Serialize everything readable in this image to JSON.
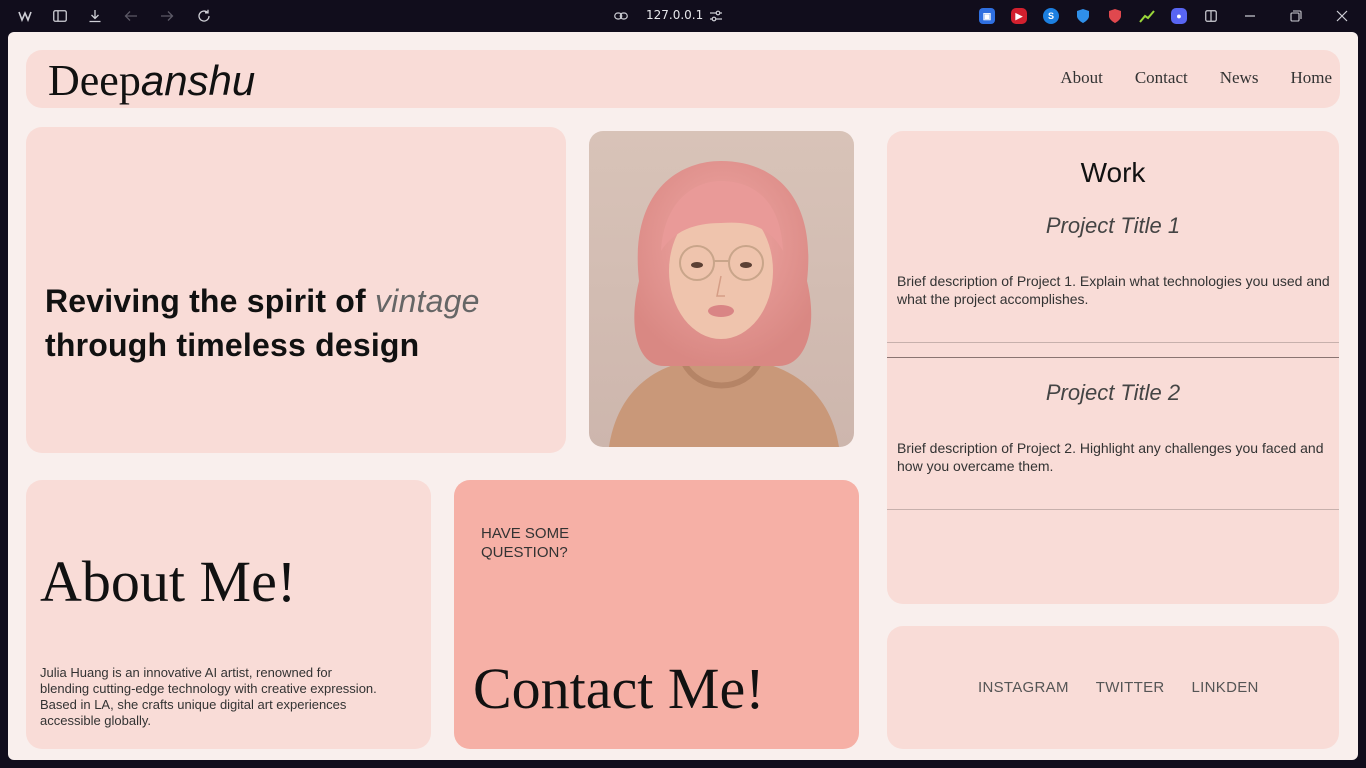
{
  "browser": {
    "url": "127.0.0.1"
  },
  "site": {
    "logo_regular": "Deep",
    "logo_italic": "anshu",
    "nav": [
      "About",
      "Contact",
      "News",
      "Home"
    ]
  },
  "hero": {
    "line1": "Reviving the spirit of",
    "emphasis": "vintage",
    "line2": "through timeless design"
  },
  "photo": {
    "subject": "portrait of a woman with pink bob hair and round glasses"
  },
  "work": {
    "title": "Work",
    "projects": [
      {
        "title": "Project Title 1",
        "description": "Brief description of Project 1. Explain what technologies you used and what the project accomplishes."
      },
      {
        "title": "Project Title 2",
        "description": "Brief description of Project 2. Highlight any challenges you faced and how you overcame them."
      }
    ]
  },
  "about": {
    "heading": "About Me!",
    "text": "Julia Huang is an innovative AI artist, renowned for blending cutting-edge technology with creative expression. Based in LA, she crafts unique digital art experiences accessible globally."
  },
  "contact": {
    "question": "HAVE SOME QUESTION?",
    "heading": "Contact Me!"
  },
  "social": {
    "links": [
      "INSTAGRAM",
      "TWITTER",
      "LINKDEN"
    ]
  },
  "colors": {
    "page_bg": "#f9efed",
    "card_bg": "#f9dcd7",
    "contact_bg": "#f6b0a6",
    "chrome_bg": "#110d1c"
  }
}
